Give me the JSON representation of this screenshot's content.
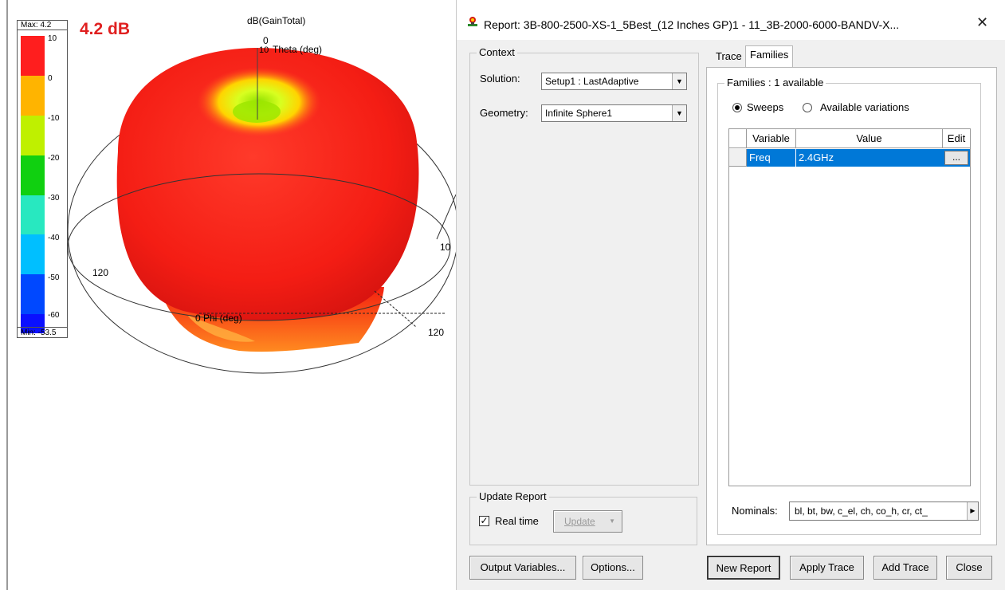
{
  "plot": {
    "title": "dB(GainTotal)",
    "gain_value": "4.2 dB",
    "legend": {
      "max_label": "Max: 4.2",
      "min_label": "Min: -53.5",
      "ticks": [
        "10",
        "0",
        "-10",
        "-20",
        "-30",
        "-40",
        "-50",
        "-60"
      ],
      "colors": [
        "#ff2020",
        "#ffb400",
        "#b8f000",
        "#00d400",
        "#20e8c0",
        "#00c0ff",
        "#0050ff",
        "#0010ff"
      ]
    },
    "axes": {
      "theta_zero": "0",
      "theta_label": "Theta (deg)",
      "theta_tick": "10",
      "phi_label": "0  Phi (deg)",
      "label_120_left": "120",
      "label_120_right": "120",
      "label_10_right": "10"
    }
  },
  "dialog": {
    "title": "Report: 3B-800-2500-XS-1_5Best_(12 Inches GP)1 - 11_3B-2000-6000-BANDV-X...",
    "close_glyph": "✕",
    "context": {
      "group_label": "Context",
      "solution_label": "Solution:",
      "solution_value": "Setup1 : LastAdaptive",
      "geometry_label": "Geometry:",
      "geometry_value": "Infinite Sphere1"
    },
    "update_report": {
      "group_label": "Update Report",
      "realtime_label": "Real time",
      "realtime_checked": true,
      "update_button": "Update"
    },
    "tabs": [
      {
        "label": "Trace",
        "active": false
      },
      {
        "label": "Families",
        "active": true
      }
    ],
    "families": {
      "group_label": "Families : 1 available",
      "radio_sweeps": "Sweeps",
      "radio_variations": "Available variations",
      "selected": "Sweeps",
      "table": {
        "headers": [
          "Variable",
          "Value",
          "Edit"
        ],
        "rows": [
          {
            "variable": "Freq",
            "value": "2.4GHz",
            "edit": "..."
          }
        ]
      },
      "nominals_label": "Nominals:",
      "nominals_value": "bl, bt, bw, c_el, ch, co_h, cr, ct_"
    },
    "buttons": {
      "output_variables": "Output Variables...",
      "options": "Options...",
      "new_report": "New Report",
      "apply_trace": "Apply Trace",
      "add_trace": "Add Trace",
      "close": "Close"
    },
    "colors": {
      "selection": "#0078d7",
      "dialog_bg": "#f0f0f0"
    }
  }
}
